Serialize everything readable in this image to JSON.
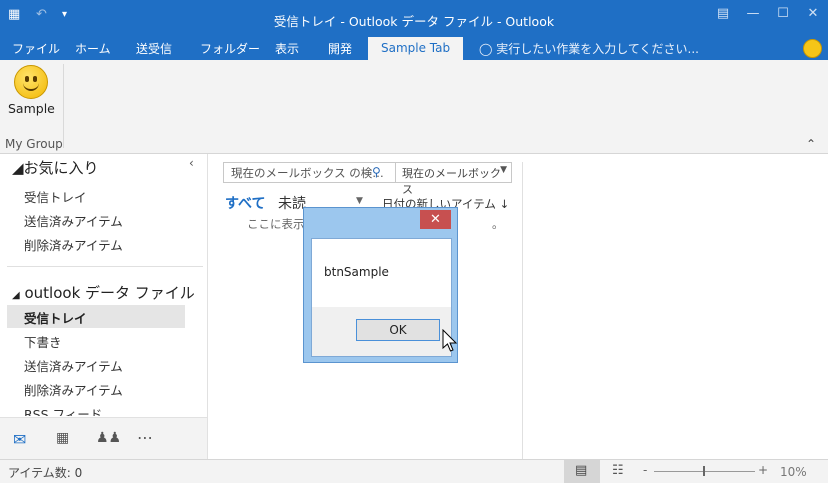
{
  "window": {
    "title": "受信トレイ - Outlook データ ファイル - Outlook"
  },
  "ribbon": {
    "tabs": [
      "ファイル",
      "ホーム",
      "送受信",
      "フォルダー",
      "表示",
      "開発",
      "Sample Tab"
    ],
    "active_tab": "Sample Tab",
    "tell_me": "実行したい作業を入力してください...",
    "sample_button_label": "Sample",
    "group_label": "My Group"
  },
  "nav": {
    "favorites_header": "お気に入り",
    "favorites": [
      "受信トレイ",
      "送信済みアイテム",
      "削除済みアイテム"
    ],
    "datafile_header": "outlook データ ファイル",
    "datafile_items": [
      "受信トレイ",
      "下書き",
      "送信済みアイテム",
      "削除済みアイテム",
      "RSS フィード"
    ],
    "selected": "受信トレイ"
  },
  "list": {
    "search_placeholder": "現在のメールボックス の検…",
    "scope": "現在のメールボックス",
    "filter_all": "すべて",
    "filter_unread": "未読",
    "sort_label": "日付の新しいアイテム",
    "empty_message_start": "ここに表示す",
    "empty_message_end": "。"
  },
  "dialog": {
    "close_glyph": "✕",
    "message": "btnSample",
    "ok_label": "OK"
  },
  "status": {
    "items_text": "アイテム数: 0",
    "zoom_level": "10%",
    "zoom_minus": "-",
    "zoom_plus": "+"
  },
  "colors": {
    "accent": "#1f6fc5",
    "dialog_frame": "#9cc7ee",
    "close_button": "#c75050"
  }
}
